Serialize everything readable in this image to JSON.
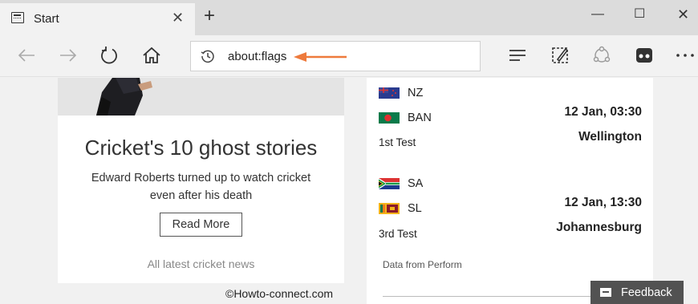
{
  "tab": {
    "title": "Start",
    "close_glyph": "✕",
    "new_tab_glyph": "+"
  },
  "window": {
    "minimize_glyph": "—",
    "maximize_glyph": "☐",
    "close_glyph": "✕"
  },
  "address_bar": {
    "url": "about:flags",
    "arrow_color": "#ee7a3c"
  },
  "article_card": {
    "title": "Cricket's 10 ghost stories",
    "description": "Edward Roberts turned up to watch cricket even after his death",
    "button_label": "Read More",
    "link_text": "All latest cricket news"
  },
  "watermark": "©Howto-connect.com",
  "matches": [
    {
      "team1": "NZ",
      "team2": "BAN",
      "type": "1st Test",
      "time": "12 Jan, 03:30",
      "venue": "Wellington"
    },
    {
      "team1": "SA",
      "team2": "SL",
      "type": "3rd Test",
      "time": "12 Jan, 13:30",
      "venue": "Johannesburg"
    }
  ],
  "data_source": "Data from Perform",
  "feedback_label": "Feedback",
  "icons": [
    "back-icon",
    "forward-icon",
    "refresh-icon",
    "home-icon",
    "history-icon",
    "reading-view-icon",
    "web-note-icon",
    "share-icon",
    "hub-icon",
    "more-icon"
  ]
}
